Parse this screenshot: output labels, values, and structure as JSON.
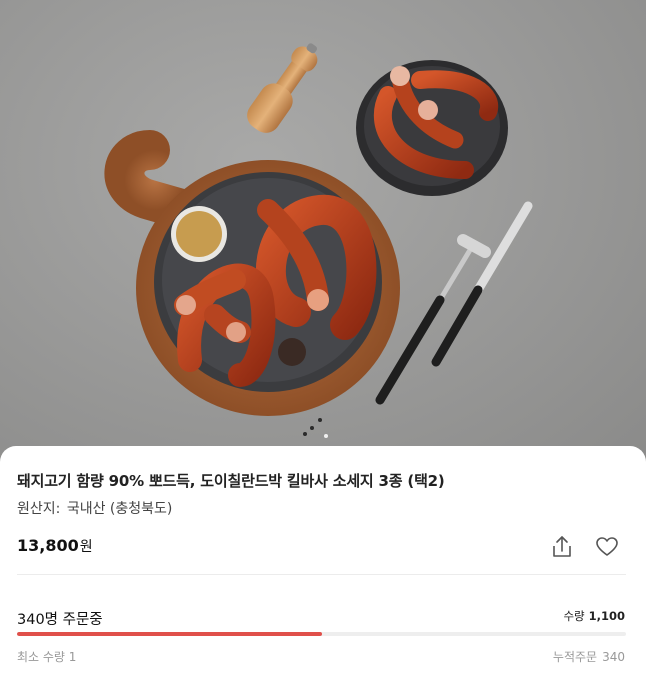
{
  "product": {
    "title": "돼지고기 함량 90% 뽀드득, 도이칠란드박 킬바사 소세지 3종 (택2)",
    "origin_label": "원산지:",
    "origin_value": "국내산 (충청북도)",
    "price_number": "13,800",
    "price_unit": "원"
  },
  "actions": {
    "share_icon": "share-icon",
    "like_icon": "heart-icon"
  },
  "order_status": {
    "ordering_text": "340명 주문중",
    "quantity_label": "수량",
    "quantity_value": "1,100",
    "progress_fraction": 0.5,
    "min_quantity_text": "최소 수량 1",
    "cumulative_label": "누적주문",
    "cumulative_value": "340"
  },
  "colors": {
    "accent": "#e0504a",
    "background_photo": "#9b9b9a"
  }
}
